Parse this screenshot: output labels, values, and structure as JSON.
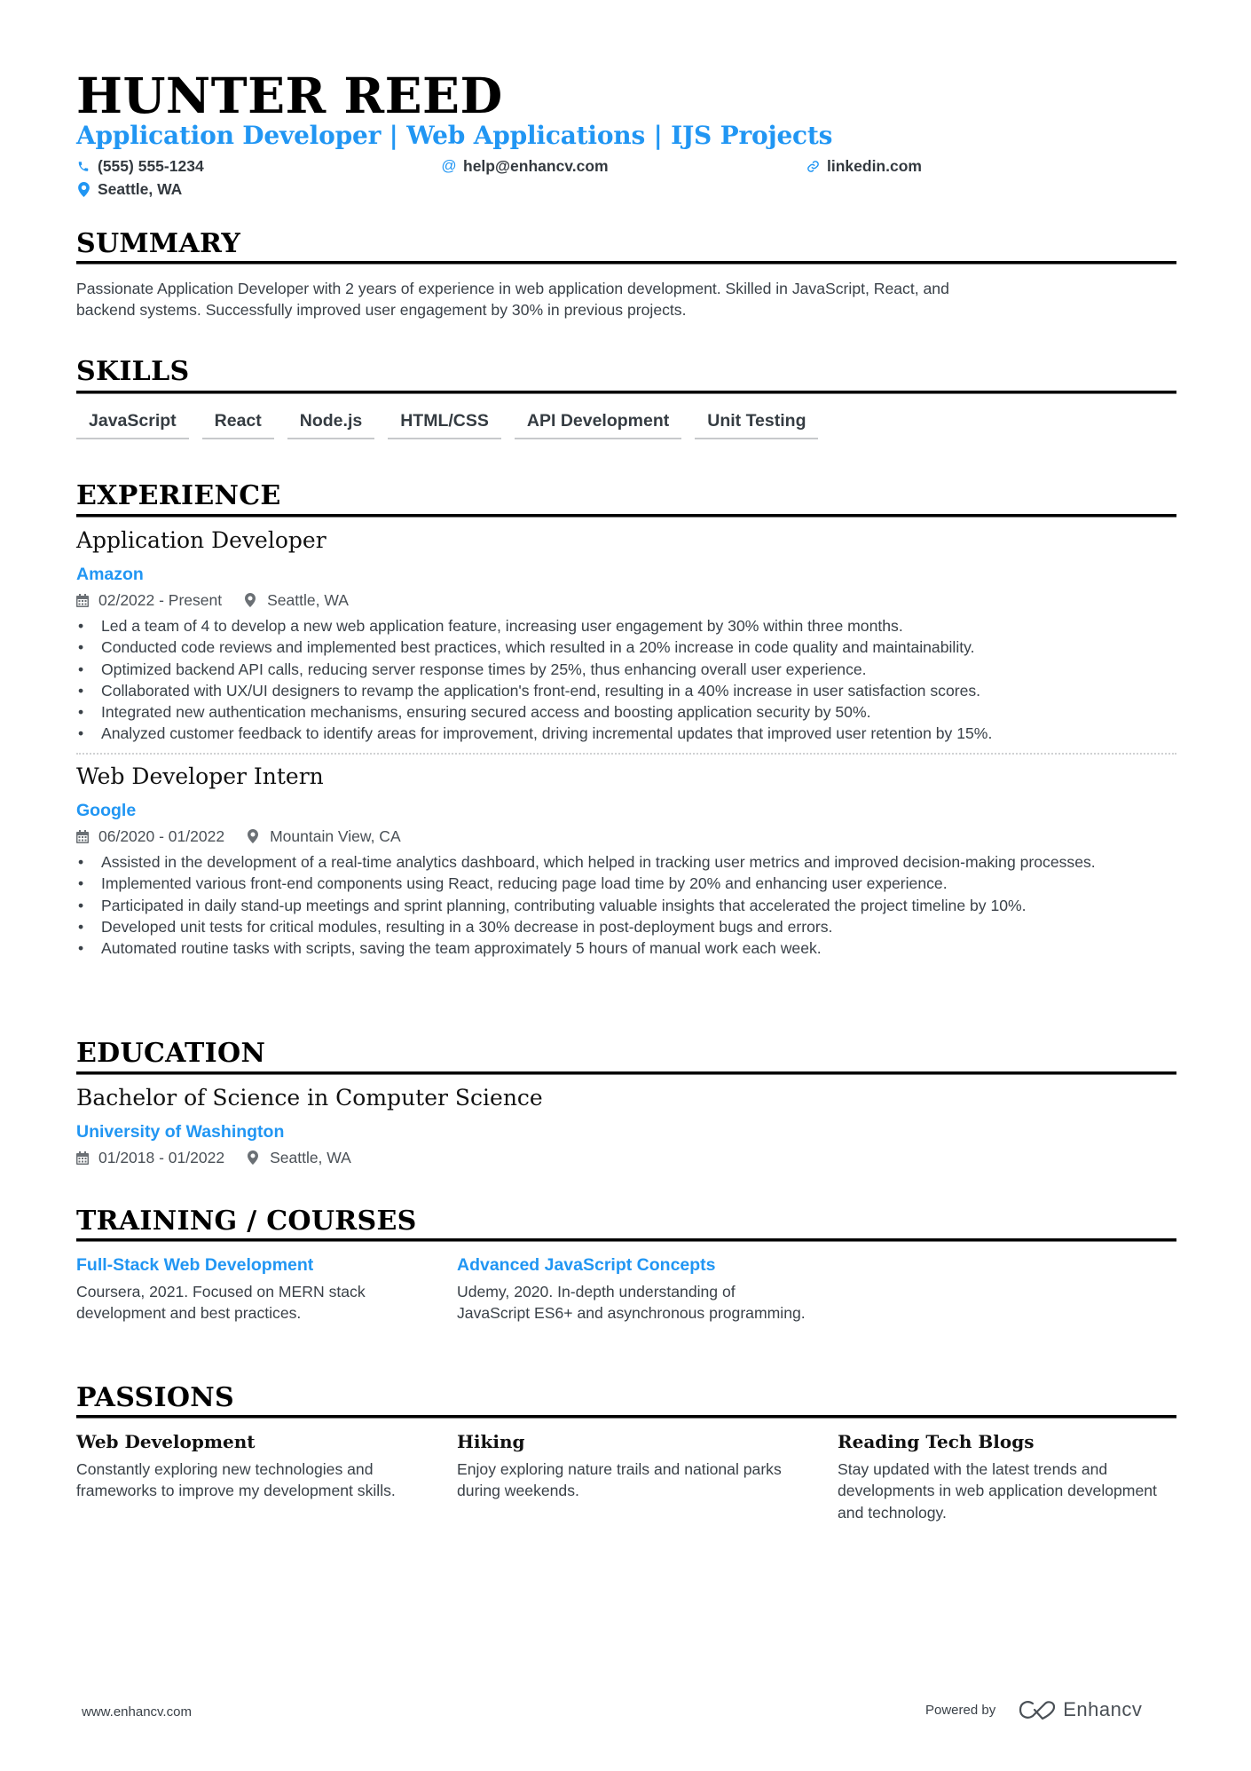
{
  "header": {
    "name": "HUNTER REED",
    "subtitle": "Application Developer | Web Applications | IJS Projects",
    "contacts": {
      "phone": {
        "icon": "phone-icon",
        "text": "(555) 555-1234"
      },
      "email": {
        "icon": "at-icon",
        "text": "help@enhancv.com"
      },
      "linkedin": {
        "icon": "link-icon",
        "text": "linkedin.com"
      },
      "location": {
        "icon": "location-pin-icon",
        "text": "Seattle, WA"
      }
    }
  },
  "colors": {
    "accent": "#2196f3",
    "text": "#3a4148",
    "heading": "#000000"
  },
  "summary": {
    "title": "SUMMARY",
    "lines": [
      "Passionate Application Developer with 2 years of experience in web application development. Skilled in JavaScript, React, and",
      "backend systems. Successfully improved user engagement by 30% in previous projects."
    ]
  },
  "skills": {
    "title": "SKILLS",
    "items": [
      "JavaScript",
      "React",
      "Node.js",
      "HTML/CSS",
      "API Development",
      "Unit Testing"
    ]
  },
  "experience": {
    "title": "EXPERIENCE",
    "jobs": [
      {
        "title": "Application Developer",
        "company": "Amazon",
        "dates": "02/2022 - Present",
        "location": "Seattle, WA",
        "bullets": [
          "Led a team of 4 to develop a new web application feature, increasing user engagement by 30% within three months.",
          "Conducted code reviews and implemented best practices, which resulted in a 20% increase in code quality and maintainability.",
          "Optimized backend API calls, reducing server response times by 25%, thus enhancing overall user experience.",
          "Collaborated with UX/UI designers to revamp the application's front-end, resulting in a 40% increase in user satisfaction scores.",
          "Integrated new authentication mechanisms, ensuring secured access and boosting application security by 50%.",
          "Analyzed customer feedback to identify areas for improvement, driving incremental updates that improved user retention by 15%."
        ]
      },
      {
        "title": "Web Developer Intern",
        "company": "Google",
        "dates": "06/2020 - 01/2022",
        "location": "Mountain View, CA",
        "bullets": [
          "Assisted in the development of a real-time analytics dashboard, which helped in tracking user metrics and improved decision-making processes.",
          "Implemented various front-end components using React, reducing page load time by 20% and enhancing user experience.",
          "Participated in daily stand-up meetings and sprint planning, contributing valuable insights that accelerated the project timeline by 10%.",
          "Developed unit tests for critical modules, resulting in a 30% decrease in post-deployment bugs and errors.",
          "Automated routine tasks with scripts, saving the team approximately 5 hours of manual work each week."
        ]
      }
    ]
  },
  "education": {
    "title": "EDUCATION",
    "entries": [
      {
        "degree": "Bachelor of Science in Computer Science",
        "school": "University of Washington",
        "dates": "01/2018 - 01/2022",
        "location": "Seattle, WA"
      }
    ]
  },
  "training": {
    "title": "TRAINING / COURSES",
    "items": [
      {
        "title": "Full-Stack Web Development",
        "description": "Coursera, 2021. Focused on MERN stack development and best practices."
      },
      {
        "title": "Advanced JavaScript Concepts",
        "description": "Udemy, 2020. In-depth understanding of JavaScript ES6+ and asynchronous programming."
      }
    ]
  },
  "passions": {
    "title": "PASSIONS",
    "items": [
      {
        "title": "Web Development",
        "description": "Constantly exploring new technologies and frameworks to improve my development skills."
      },
      {
        "title": "Hiking",
        "description": "Enjoy exploring nature trails and national parks during weekends."
      },
      {
        "title": "Reading Tech Blogs",
        "description": "Stay updated with the latest trends and developments in web application development and technology."
      }
    ]
  },
  "footer": {
    "website": "www.enhancv.com",
    "powered_by": "Powered by",
    "brand": "Enhancv"
  }
}
